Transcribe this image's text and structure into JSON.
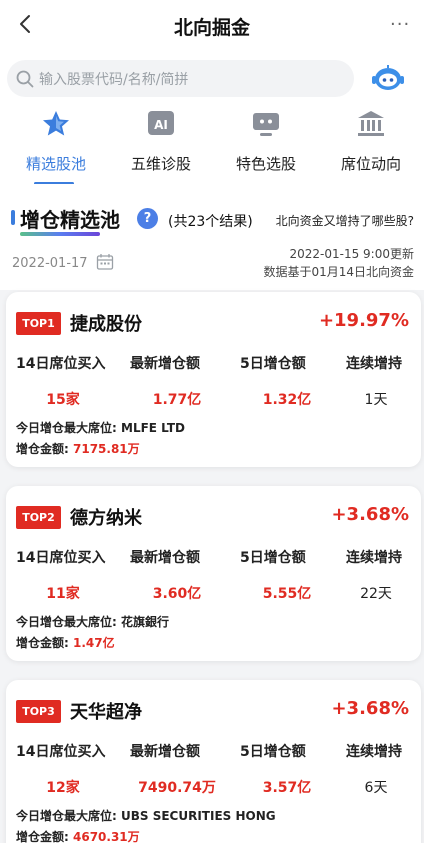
{
  "header": {
    "title": "北向掘金",
    "more": "···"
  },
  "search": {
    "placeholder": "输入股票代码/名称/简拼"
  },
  "nav": [
    {
      "label": "精选股池",
      "icon": "star-icon",
      "active": true
    },
    {
      "label": "五维诊股",
      "icon": "ai-icon",
      "active": false
    },
    {
      "label": "特色选股",
      "icon": "monitor-icon",
      "active": false
    },
    {
      "label": "席位动向",
      "icon": "bank-icon",
      "active": false
    }
  ],
  "section": {
    "title": "增仓精选池",
    "help": "?",
    "count": "(共23个结果)",
    "link": "北向资金又增持了哪些股?",
    "date": "2022-01-17",
    "update_time": "2022-01-15 9:00更新",
    "data_basis": "数据基于01月14日北向资金"
  },
  "columns": [
    "14日席位买入",
    "最新增仓额",
    "5日增仓额",
    "连续增持"
  ],
  "cards": [
    {
      "rank": "TOP1",
      "name": "捷成股份",
      "change": "+19.97%",
      "seats": "15家",
      "latest": "1.77亿",
      "five_day": "1.32亿",
      "streak": "1天",
      "max_seat_label": "今日增仓最大席位:",
      "max_seat": "MLFE LTD",
      "amount_label": "增仓金额:",
      "amount": "7175.81万"
    },
    {
      "rank": "TOP2",
      "name": "德方纳米",
      "change": "+3.68%",
      "seats": "11家",
      "latest": "3.60亿",
      "five_day": "5.55亿",
      "streak": "22天",
      "max_seat_label": "今日增仓最大席位:",
      "max_seat": "花旗銀行",
      "amount_label": "增仓金额:",
      "amount": "1.47亿"
    },
    {
      "rank": "TOP3",
      "name": "天华超净",
      "change": "+3.68%",
      "seats": "12家",
      "latest": "7490.74万",
      "five_day": "3.57亿",
      "streak": "6天",
      "max_seat_label": "今日增仓最大席位:",
      "max_seat": "UBS SECURITIES HONG",
      "amount_label": "增仓金额:",
      "amount": "4670.31万"
    }
  ],
  "colors": {
    "accent": "#3b7ddd",
    "red": "#e02b22"
  }
}
